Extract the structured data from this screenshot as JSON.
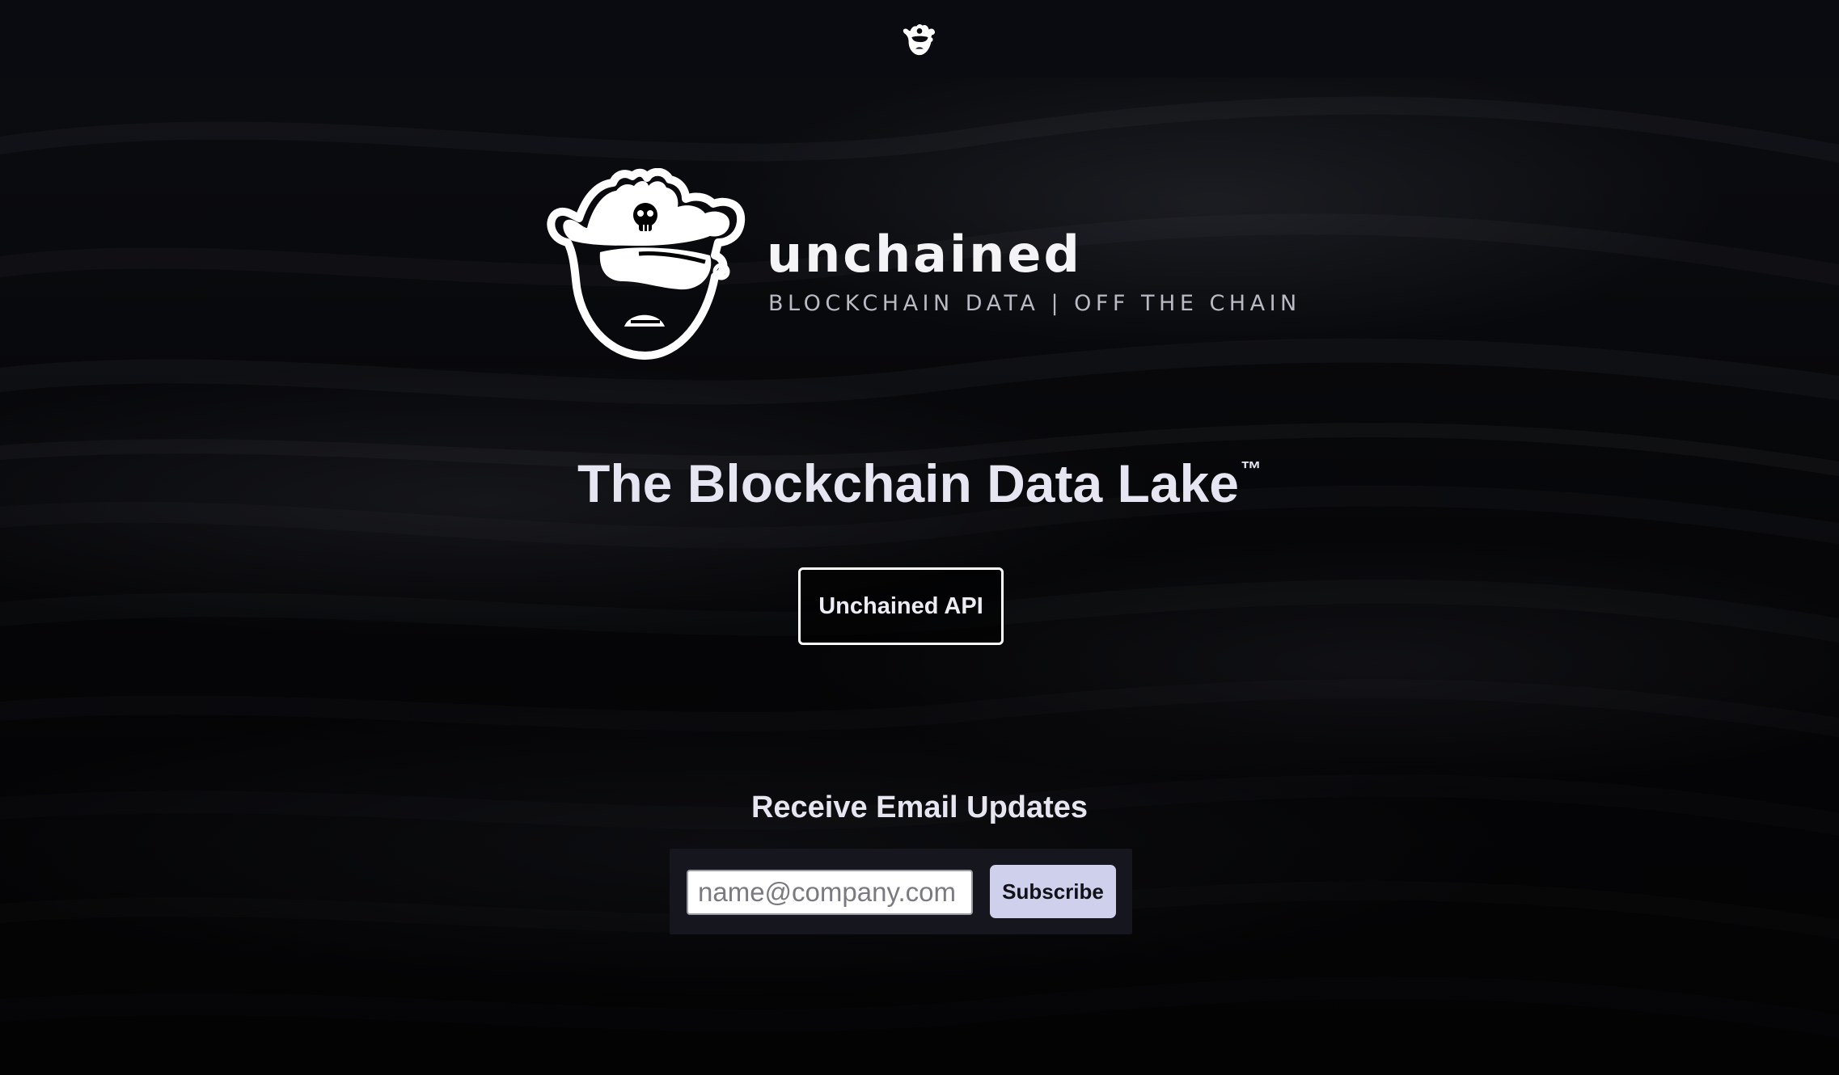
{
  "header": {
    "logo_icon": "pirate-logo-icon"
  },
  "hero": {
    "logo_icon": "pirate-mascot-icon",
    "brand_name": "unchained",
    "tagline": "BLOCKCHAIN DATA | OFF THE CHAIN"
  },
  "headline": {
    "text": "The Blockchain Data Lake",
    "trademark": "™"
  },
  "api_button": {
    "label": "Unchained API"
  },
  "email_updates": {
    "heading": "Receive Email Updates",
    "input_placeholder": "name@company.com",
    "input_value": "",
    "subscribe_label": "Subscribe"
  },
  "colors": {
    "background": "#050507",
    "topbar": "#0a0b10",
    "text": "#e6e6f2",
    "subscribe_button": "#cfd0ec",
    "form_panel": "#15161e"
  }
}
